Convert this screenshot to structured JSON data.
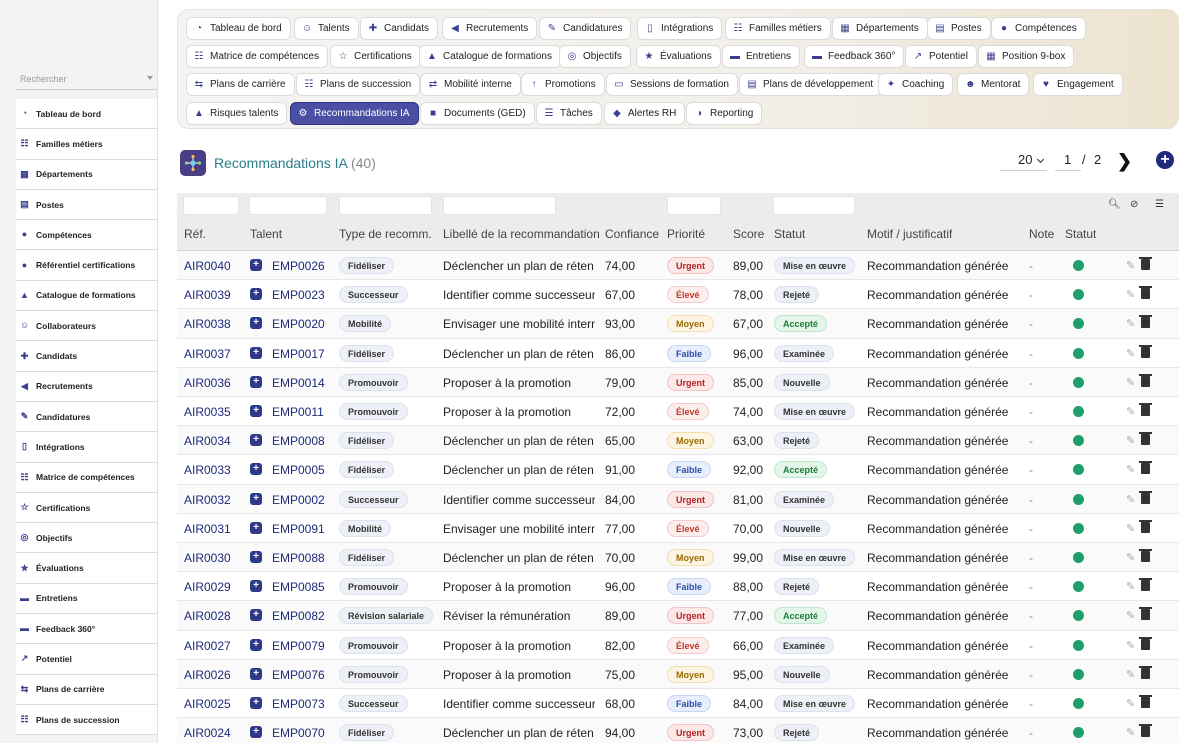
{
  "sidebar": {
    "search_placeholder": "Rechercher",
    "items": [
      {
        "label": "Tableau de bord",
        "icon": "dashboard-icon"
      },
      {
        "label": "Familles métiers",
        "icon": "sitemap-icon"
      },
      {
        "label": "Départements",
        "icon": "building-icon"
      },
      {
        "label": "Postes",
        "icon": "id-card-icon"
      },
      {
        "label": "Compétences",
        "icon": "brain-icon"
      },
      {
        "label": "Référentiel certifications",
        "icon": "certificate-icon"
      },
      {
        "label": "Catalogue de formations",
        "icon": "graduation-cap-icon"
      },
      {
        "label": "Collaborateurs",
        "icon": "user-icon"
      },
      {
        "label": "Candidats",
        "icon": "user-plus-icon"
      },
      {
        "label": "Recrutements",
        "icon": "megaphone-icon"
      },
      {
        "label": "Candidatures",
        "icon": "file-edit-icon"
      },
      {
        "label": "Intégrations",
        "icon": "door-icon"
      },
      {
        "label": "Matrice de compétences",
        "icon": "sitemap-icon"
      },
      {
        "label": "Certifications",
        "icon": "award-icon"
      },
      {
        "label": "Objectifs",
        "icon": "target-icon"
      },
      {
        "label": "Évaluations",
        "icon": "star-icon"
      },
      {
        "label": "Entretiens",
        "icon": "comments-icon"
      },
      {
        "label": "Feedback 360°",
        "icon": "comment-icon"
      },
      {
        "label": "Potentiel",
        "icon": "chart-line-icon"
      },
      {
        "label": "Plans de carrière",
        "icon": "route-icon"
      },
      {
        "label": "Plans de succession",
        "icon": "sitemap-icon"
      }
    ]
  },
  "menu": {
    "chips": [
      {
        "label": "Tableau de bord",
        "icon": "dashboard-icon",
        "active": false
      },
      {
        "label": "Talents",
        "icon": "user-icon",
        "active": false
      },
      {
        "label": "Candidats",
        "icon": "user-plus-icon",
        "active": false
      },
      {
        "label": "Recrutements",
        "icon": "megaphone-icon",
        "active": false
      },
      {
        "label": "Candidatures",
        "icon": "file-edit-icon",
        "active": false
      },
      {
        "label": "Intégrations",
        "icon": "door-icon",
        "active": false
      },
      {
        "label": "Familles métiers",
        "icon": "sitemap-icon",
        "active": false
      },
      {
        "label": "Départements",
        "icon": "building-icon",
        "active": false
      },
      {
        "label": "Postes",
        "icon": "id-card-icon",
        "active": false
      },
      {
        "label": "Compétences",
        "icon": "brain-icon",
        "active": false
      },
      {
        "label": "Matrice de compétences",
        "icon": "sitemap-icon",
        "active": false
      },
      {
        "label": "Certifications",
        "icon": "award-icon",
        "active": false
      },
      {
        "label": "Catalogue de formations",
        "icon": "graduation-cap-icon",
        "active": false
      },
      {
        "label": "Objectifs",
        "icon": "target-icon",
        "active": false
      },
      {
        "label": "Évaluations",
        "icon": "star-icon",
        "active": false
      },
      {
        "label": "Entretiens",
        "icon": "comments-icon",
        "active": false
      },
      {
        "label": "Feedback 360°",
        "icon": "comment-icon",
        "active": false
      },
      {
        "label": "Potentiel",
        "icon": "chart-line-icon",
        "active": false
      },
      {
        "label": "Position 9-box",
        "icon": "grid-icon",
        "active": false
      },
      {
        "label": "Plans de carrière",
        "icon": "route-icon",
        "active": false
      },
      {
        "label": "Plans de succession",
        "icon": "sitemap-icon",
        "active": false
      },
      {
        "label": "Mobilité interne",
        "icon": "exchange-icon",
        "active": false
      },
      {
        "label": "Promotions",
        "icon": "arrow-up-icon",
        "active": false
      },
      {
        "label": "Sessions de formation",
        "icon": "chalkboard-icon",
        "active": false
      },
      {
        "label": "Plans de développement",
        "icon": "clipboard-icon",
        "active": false
      },
      {
        "label": "Coaching",
        "icon": "handshake-icon",
        "active": false
      },
      {
        "label": "Mentorat",
        "icon": "mentor-icon",
        "active": false
      },
      {
        "label": "Engagement",
        "icon": "heart-icon",
        "active": false
      },
      {
        "label": "Risques talents",
        "icon": "warning-icon",
        "active": false
      },
      {
        "label": "Recommandations IA",
        "icon": "robot-icon",
        "active": true
      },
      {
        "label": "Documents (GED)",
        "icon": "folder-icon",
        "active": false
      },
      {
        "label": "Tâches",
        "icon": "tasks-icon",
        "active": false
      },
      {
        "label": "Alertes RH",
        "icon": "bell-icon",
        "active": false
      },
      {
        "label": "Reporting",
        "icon": "pie-chart-icon",
        "active": false
      }
    ]
  },
  "header": {
    "title": "Recommandations IA",
    "count": "(40)",
    "logo_icon": "ai-network-icon"
  },
  "pager": {
    "page_size": "20",
    "current_page": "1",
    "separator": "/",
    "total_pages": "2"
  },
  "table": {
    "columns": [
      "Réf.",
      "Talent",
      "Type de recomm...",
      "Libellé de la recommandation",
      "Confiance",
      "Priorité",
      "Score",
      "Statut",
      "Motif / justificatif",
      "Note",
      "Statut"
    ],
    "rows": [
      {
        "ref": "AIR0040",
        "talent": "EMP0026",
        "type": "Fidéliser",
        "label": "Déclencher un plan de réten…",
        "confiance": "74,00",
        "priorite": "Urgent",
        "score": "89,00",
        "statut": "Mise en œuvre",
        "motif": "Recommandation générée …",
        "note": "-"
      },
      {
        "ref": "AIR0039",
        "talent": "EMP0023",
        "type": "Successeur",
        "label": "Identifier comme successeur",
        "confiance": "67,00",
        "priorite": "Élevé",
        "score": "78,00",
        "statut": "Rejeté",
        "motif": "Recommandation générée …",
        "note": "-"
      },
      {
        "ref": "AIR0038",
        "talent": "EMP0020",
        "type": "Mobilité",
        "label": "Envisager une mobilité interne",
        "confiance": "93,00",
        "priorite": "Moyen",
        "score": "67,00",
        "statut": "Accepté",
        "motif": "Recommandation générée …",
        "note": "-"
      },
      {
        "ref": "AIR0037",
        "talent": "EMP0017",
        "type": "Fidéliser",
        "label": "Déclencher un plan de réten…",
        "confiance": "86,00",
        "priorite": "Faible",
        "score": "96,00",
        "statut": "Examinée",
        "motif": "Recommandation générée …",
        "note": "-"
      },
      {
        "ref": "AIR0036",
        "talent": "EMP0014",
        "type": "Promouvoir",
        "label": "Proposer à la promotion",
        "confiance": "79,00",
        "priorite": "Urgent",
        "score": "85,00",
        "statut": "Nouvelle",
        "motif": "Recommandation générée …",
        "note": "-"
      },
      {
        "ref": "AIR0035",
        "talent": "EMP0011",
        "type": "Promouvoir",
        "label": "Proposer à la promotion",
        "confiance": "72,00",
        "priorite": "Élevé",
        "score": "74,00",
        "statut": "Mise en œuvre",
        "motif": "Recommandation générée …",
        "note": "-"
      },
      {
        "ref": "AIR0034",
        "talent": "EMP0008",
        "type": "Fidéliser",
        "label": "Déclencher un plan de réten…",
        "confiance": "65,00",
        "priorite": "Moyen",
        "score": "63,00",
        "statut": "Rejeté",
        "motif": "Recommandation générée …",
        "note": "-"
      },
      {
        "ref": "AIR0033",
        "talent": "EMP0005",
        "type": "Fidéliser",
        "label": "Déclencher un plan de réten…",
        "confiance": "91,00",
        "priorite": "Faible",
        "score": "92,00",
        "statut": "Accepté",
        "motif": "Recommandation générée …",
        "note": "-"
      },
      {
        "ref": "AIR0032",
        "talent": "EMP0002",
        "type": "Successeur",
        "label": "Identifier comme successeur",
        "confiance": "84,00",
        "priorite": "Urgent",
        "score": "81,00",
        "statut": "Examinée",
        "motif": "Recommandation générée …",
        "note": "-"
      },
      {
        "ref": "AIR0031",
        "talent": "EMP0091",
        "type": "Mobilité",
        "label": "Envisager une mobilité interne",
        "confiance": "77,00",
        "priorite": "Élevé",
        "score": "70,00",
        "statut": "Nouvelle",
        "motif": "Recommandation générée …",
        "note": "-"
      },
      {
        "ref": "AIR0030",
        "talent": "EMP0088",
        "type": "Fidéliser",
        "label": "Déclencher un plan de réten…",
        "confiance": "70,00",
        "priorite": "Moyen",
        "score": "99,00",
        "statut": "Mise en œuvre",
        "motif": "Recommandation générée …",
        "note": "-"
      },
      {
        "ref": "AIR0029",
        "talent": "EMP0085",
        "type": "Promouvoir",
        "label": "Proposer à la promotion",
        "confiance": "96,00",
        "priorite": "Faible",
        "score": "88,00",
        "statut": "Rejeté",
        "motif": "Recommandation générée …",
        "note": "-"
      },
      {
        "ref": "AIR0028",
        "talent": "EMP0082",
        "type": "Révision salariale",
        "label": "Réviser la rémunération",
        "confiance": "89,00",
        "priorite": "Urgent",
        "score": "77,00",
        "statut": "Accepté",
        "motif": "Recommandation générée …",
        "note": "-"
      },
      {
        "ref": "AIR0027",
        "talent": "EMP0079",
        "type": "Promouvoir",
        "label": "Proposer à la promotion",
        "confiance": "82,00",
        "priorite": "Élevé",
        "score": "66,00",
        "statut": "Examinée",
        "motif": "Recommandation générée …",
        "note": "-"
      },
      {
        "ref": "AIR0026",
        "talent": "EMP0076",
        "type": "Promouvoir",
        "label": "Proposer à la promotion",
        "confiance": "75,00",
        "priorite": "Moyen",
        "score": "95,00",
        "statut": "Nouvelle",
        "motif": "Recommandation générée …",
        "note": "-"
      },
      {
        "ref": "AIR0025",
        "talent": "EMP0073",
        "type": "Successeur",
        "label": "Identifier comme successeur",
        "confiance": "68,00",
        "priorite": "Faible",
        "score": "84,00",
        "statut": "Mise en œuvre",
        "motif": "Recommandation générée …",
        "note": "-"
      },
      {
        "ref": "AIR0024",
        "talent": "EMP0070",
        "type": "Fidéliser",
        "label": "Déclencher un plan de réten…",
        "confiance": "94,00",
        "priorite": "Urgent",
        "score": "73,00",
        "statut": "Rejeté",
        "motif": "Recommandation générée …",
        "note": "-"
      }
    ]
  },
  "colors": {
    "accent": "#4a4fa3",
    "title": "#2a7c8c",
    "link": "#1d2a7a",
    "status_dot": "#1e9e6a"
  }
}
